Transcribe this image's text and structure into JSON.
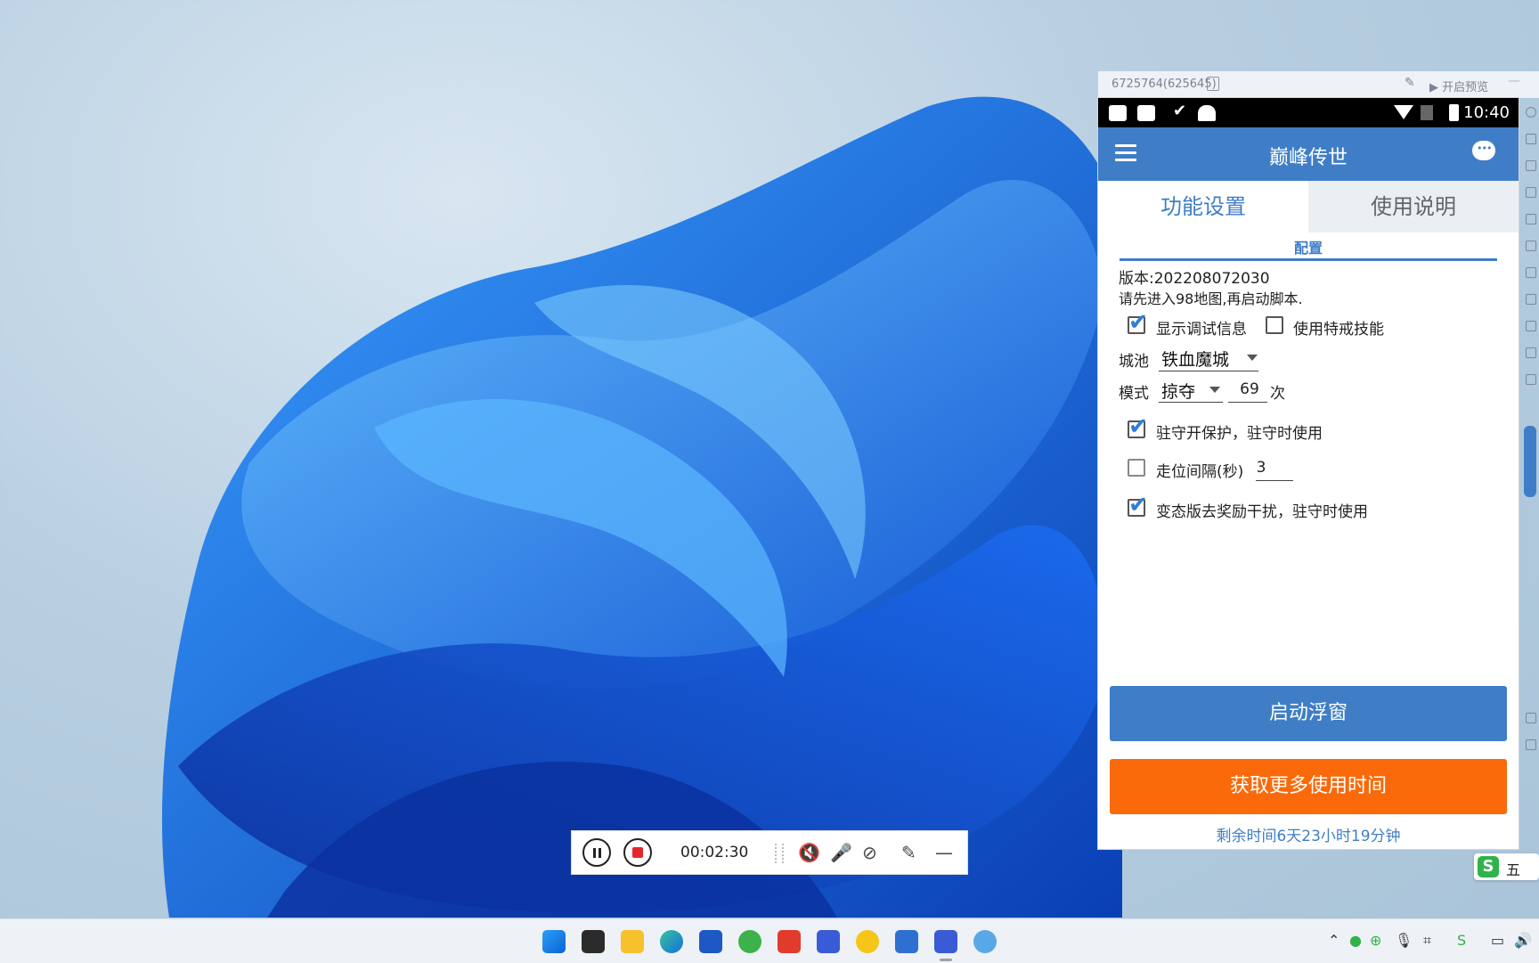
{
  "emulator": {
    "window_id": "6725764(625645)",
    "preview_label": "开启预览"
  },
  "statusbar": {
    "time": "10:40"
  },
  "app": {
    "title": "巅峰传世",
    "tabs": [
      {
        "label": "功能设置",
        "active": true
      },
      {
        "label": "使用说明",
        "active": false
      }
    ],
    "section_label": "配置",
    "version_text": "版本:202208072030",
    "instruction_text": "请先进入98地图,再启动脚本.",
    "show_debug": {
      "label": "显示调试信息",
      "checked": true
    },
    "use_special_ring": {
      "label": "使用特戒技能",
      "checked": false
    },
    "city": {
      "label": "城池",
      "value": "铁血魔城"
    },
    "mode": {
      "label": "模式",
      "value": "掠夺",
      "count": "69",
      "count_unit": "次"
    },
    "garrison_protect": {
      "label": "驻守开保护，驻守时使用",
      "checked": true
    },
    "walk_interval": {
      "label": "走位间隔(秒)",
      "value": "3",
      "checked": false
    },
    "bt_remove_reward": {
      "label": "变态版去奖励干扰，驻守时使用",
      "checked": true
    },
    "start_float_button": "启动浮窗",
    "get_more_time_button": "获取更多使用时间",
    "remaining_time": "剩余时间6天23小时19分钟"
  },
  "recorder": {
    "elapsed": "00:02:30"
  },
  "ime": {
    "mode": "五"
  },
  "colors": {
    "app_blue": "#3f7ec7",
    "orange": "#fa6a0a",
    "checkbox_blue": "#2e7fd6"
  }
}
